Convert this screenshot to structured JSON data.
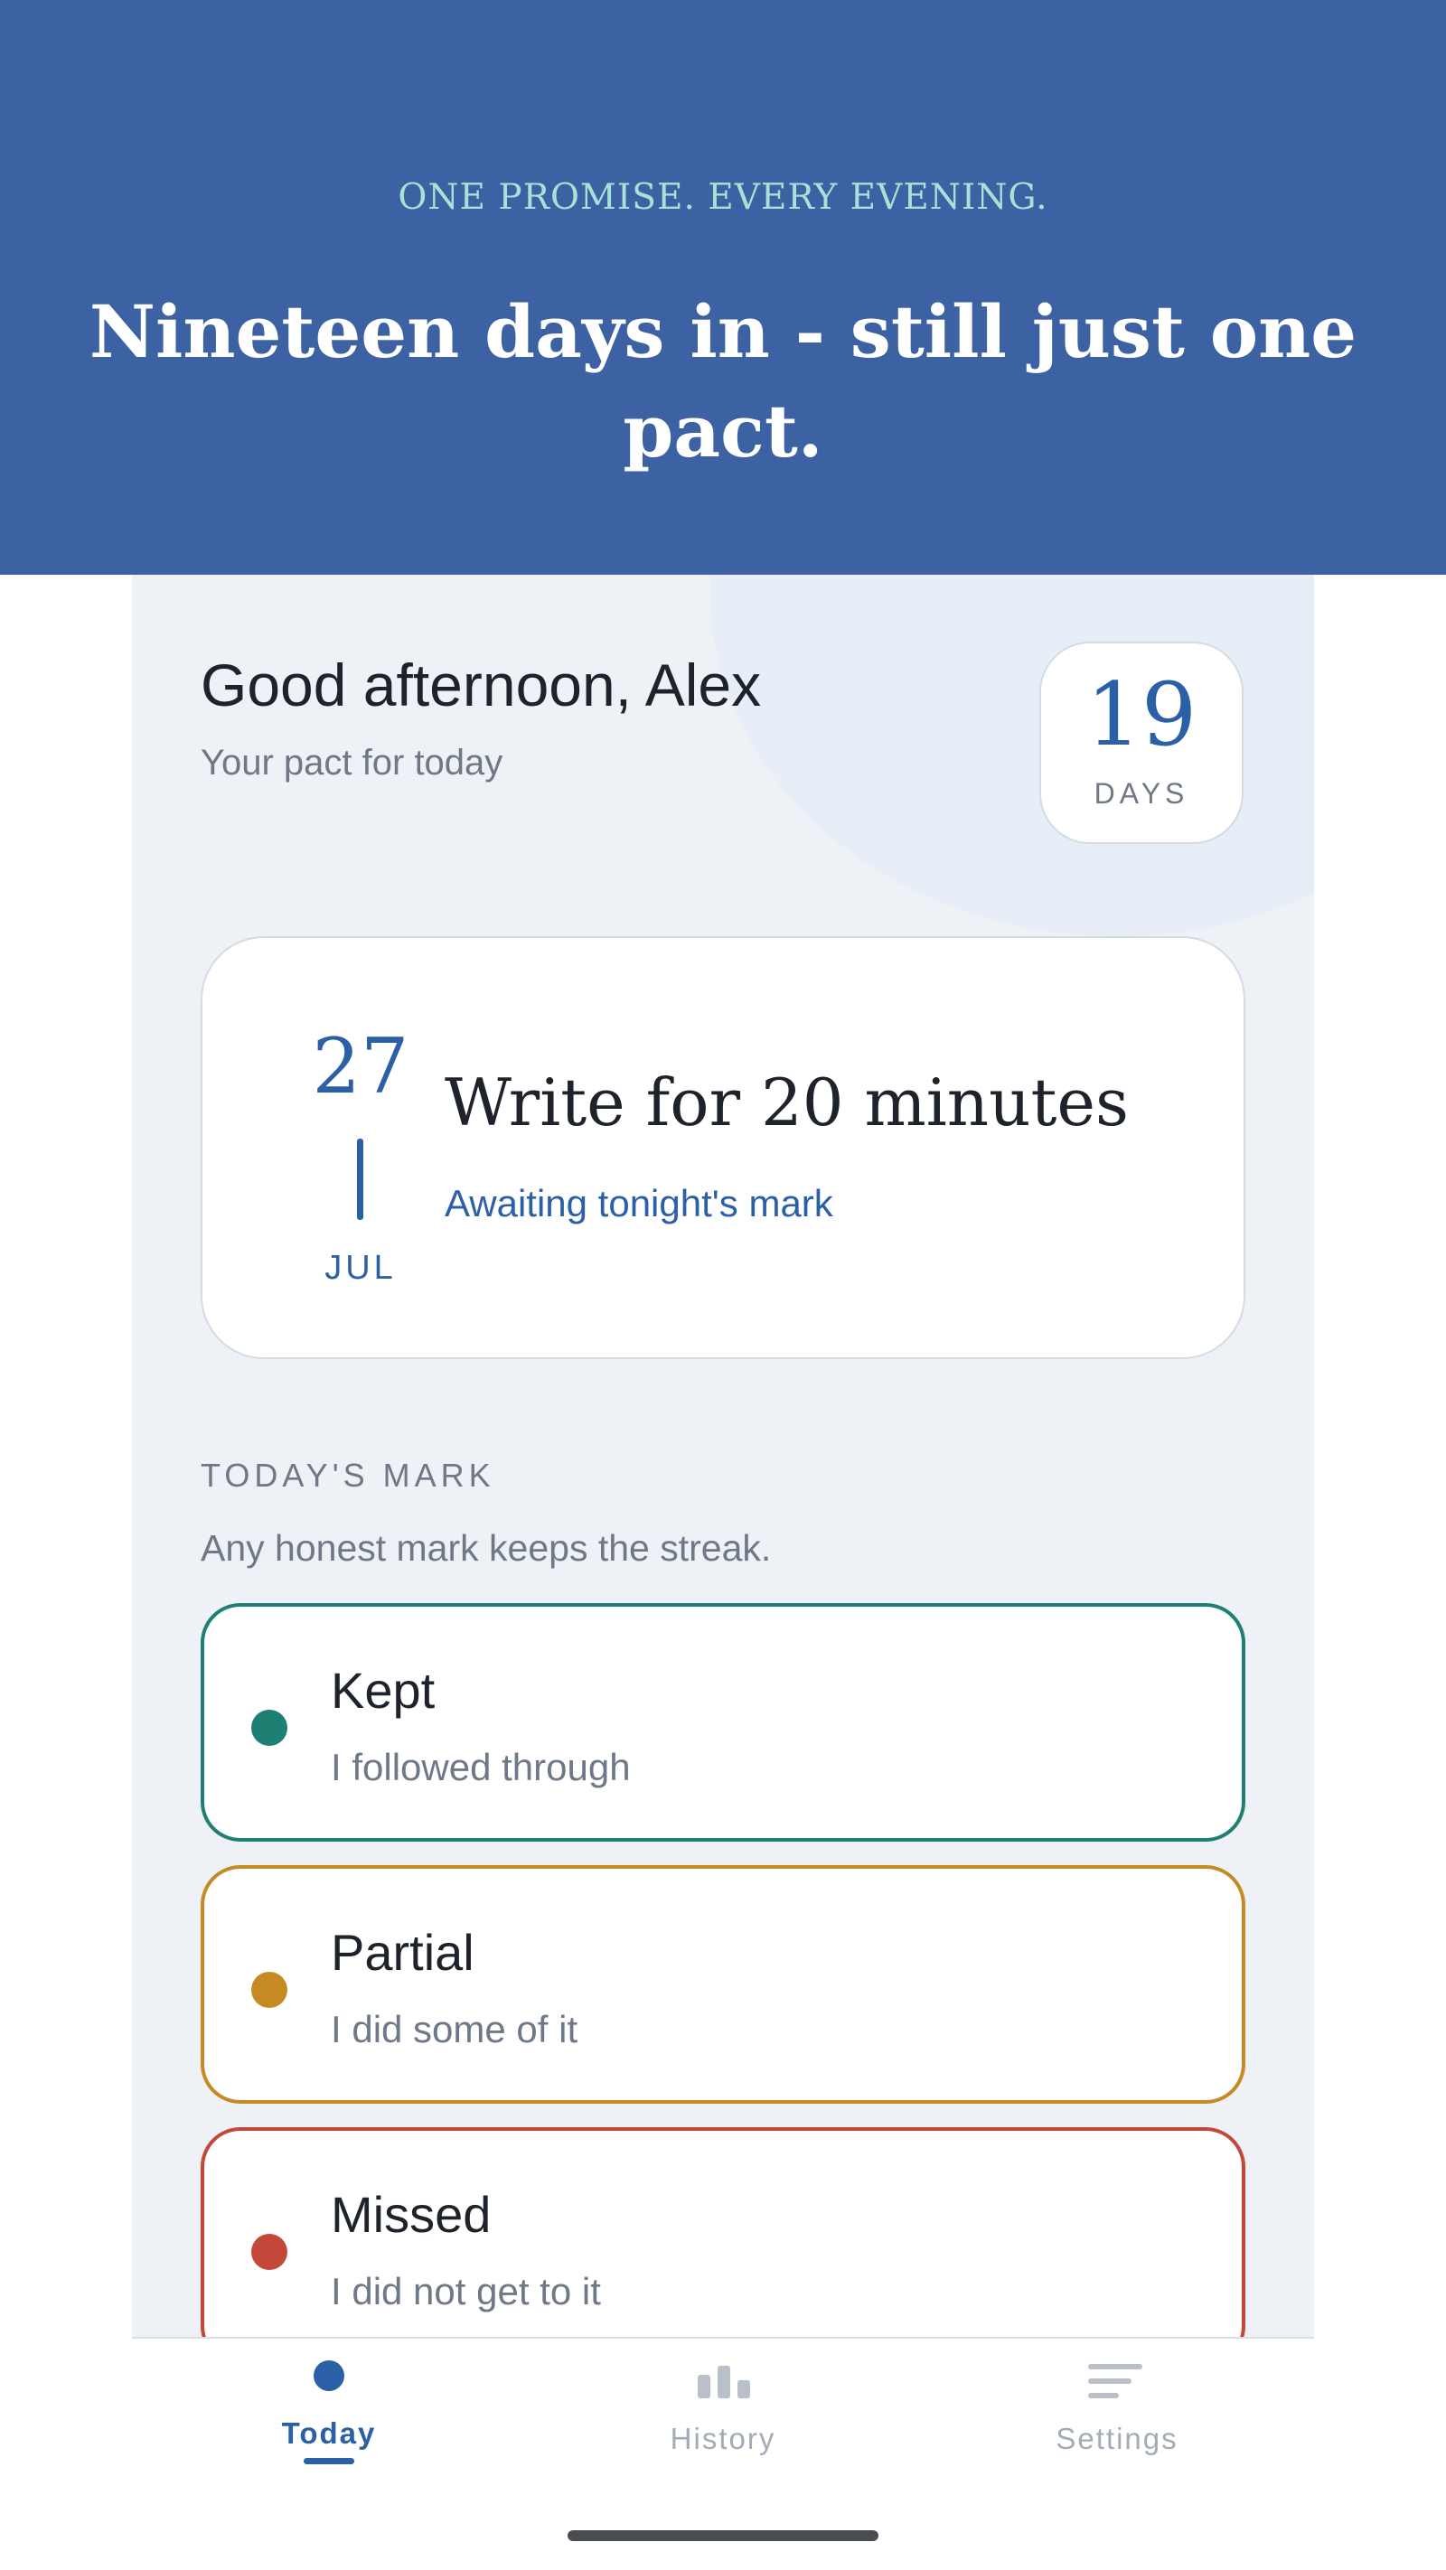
{
  "hero": {
    "eyebrow": "ONE PROMISE. EVERY EVENING.",
    "title": "Nineteen days in - still just one pact."
  },
  "header": {
    "greeting": "Good afternoon, Alex",
    "subtitle": "Your pact for today",
    "streak_count": "19",
    "streak_unit": "DAYS"
  },
  "pact": {
    "day": "27",
    "month": "JUL",
    "title": "Write for 20 minutes",
    "status": "Awaiting tonight's mark"
  },
  "marks": {
    "section_label": "TODAY'S MARK",
    "section_sub": "Any honest mark keeps the streak.",
    "options": [
      {
        "title": "Kept",
        "subtitle": "I followed through",
        "color": "#1f7f73"
      },
      {
        "title": "Partial",
        "subtitle": "I did some of it",
        "color": "#c68a24"
      },
      {
        "title": "Missed",
        "subtitle": "I did not get to it",
        "color": "#c4483a"
      }
    ]
  },
  "tabs": [
    {
      "label": "Today",
      "icon": "dot-icon",
      "active": true
    },
    {
      "label": "History",
      "icon": "bar-chart-icon",
      "active": false
    },
    {
      "label": "Settings",
      "icon": "menu-lines-icon",
      "active": false
    }
  ],
  "colors": {
    "hero_bg": "#3d62a3",
    "accent": "#2b5fa6",
    "eyebrow": "#a8e2d6"
  }
}
